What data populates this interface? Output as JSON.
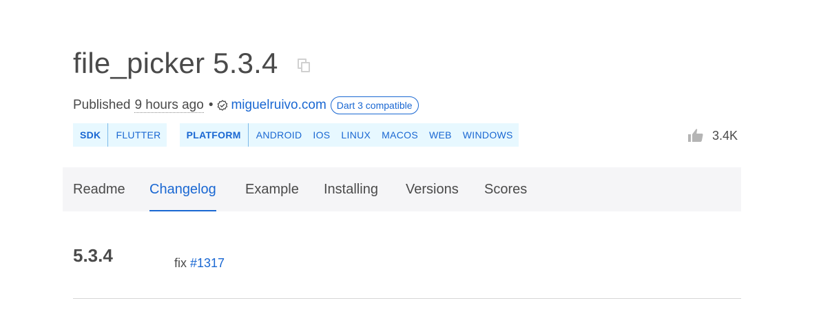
{
  "package": {
    "title": "file_picker 5.3.4"
  },
  "meta": {
    "published_label": "Published",
    "published_time": "9 hours ago",
    "separator": "•",
    "publisher": "miguelruivo.com",
    "dart3_badge": "Dart 3 compatible"
  },
  "tags": {
    "sdk": {
      "label": "SDK",
      "items": [
        "FLUTTER"
      ]
    },
    "platform": {
      "label": "PLATFORM",
      "items": [
        "ANDROID",
        "IOS",
        "LINUX",
        "MACOS",
        "WEB",
        "WINDOWS"
      ]
    }
  },
  "likes": {
    "count": "3.4K"
  },
  "tabs": [
    {
      "label": "Readme",
      "active": false
    },
    {
      "label": "Changelog",
      "active": true
    },
    {
      "label": "Example",
      "active": false
    },
    {
      "label": "Installing",
      "active": false
    },
    {
      "label": "Versions",
      "active": false
    },
    {
      "label": "Scores",
      "active": false
    }
  ],
  "changelog": {
    "version": "5.3.4",
    "entry_text": "fix",
    "issue": "#1317"
  },
  "colors": {
    "accent": "#1967d2",
    "tag_bg": "#e7f8ff",
    "tabbar_bg": "#f5f5f7",
    "text": "#4a4a4a"
  },
  "icons": {
    "copy": "copy-icon",
    "verified": "verified-publisher-icon",
    "like": "thumb-up-icon"
  }
}
